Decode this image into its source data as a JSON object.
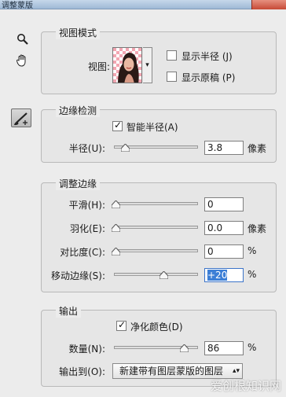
{
  "window": {
    "title": "调整蒙版"
  },
  "tools": {
    "zoom": "zoom-icon",
    "hand": "hand-icon",
    "brush": "refine-radius-brush-icon"
  },
  "view_mode": {
    "title": "视图模式",
    "view_label": "视图:",
    "show_radius": {
      "label": "显示半径 (J)",
      "checked": false
    },
    "show_original": {
      "label": "显示原稿 (P)",
      "checked": false
    }
  },
  "edge_detection": {
    "title": "边缘检测",
    "smart_radius": {
      "label": "智能半径(A)",
      "checked": true
    },
    "radius": {
      "label": "半径(U):",
      "value": "3.8",
      "unit": "像素",
      "level": 0.12
    }
  },
  "adjust_edge": {
    "title": "调整边缘",
    "smooth": {
      "label": "平滑(H):",
      "value": "0",
      "unit": "",
      "level": 0
    },
    "feather": {
      "label": "羽化(E):",
      "value": "0.0",
      "unit": "像素",
      "level": 0
    },
    "contrast": {
      "label": "对比度(C):",
      "value": "0",
      "unit": "%",
      "level": 0
    },
    "shift_edge": {
      "label": "移动边缘(S):",
      "value": "+20",
      "unit": "%",
      "level": 0.6
    }
  },
  "output": {
    "title": "输出",
    "decontaminate": {
      "label": "净化颜色(D)",
      "checked": true
    },
    "amount": {
      "label": "数量(N):",
      "value": "86",
      "unit": "%",
      "level": 0.86
    },
    "output_to": {
      "label": "输出到(O):",
      "value": "新建带有图层蒙版的图层"
    }
  },
  "watermark": "爱创根知识网"
}
